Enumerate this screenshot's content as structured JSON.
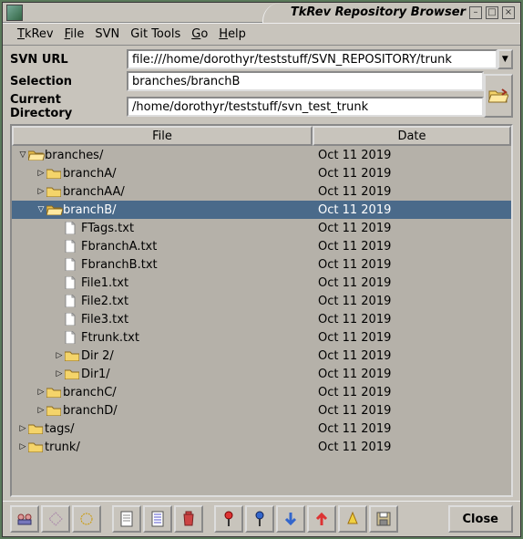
{
  "window": {
    "title": "TkRev Repository Browser"
  },
  "menubar": [
    {
      "label": "TkRev",
      "ul": 0
    },
    {
      "label": "File",
      "ul": 0
    },
    {
      "label": "SVN",
      "ul": -1
    },
    {
      "label": "Git Tools",
      "ul": -1
    },
    {
      "label": "Go",
      "ul": 0
    },
    {
      "label": "Help",
      "ul": 0
    }
  ],
  "fields": {
    "svn_url_label": "SVN URL",
    "svn_url_value": "file:///home/dorothyr/teststuff/SVN_REPOSITORY/trunk",
    "selection_label": "Selection",
    "selection_value": "branches/branchB",
    "curdir_label": "Current Directory",
    "curdir_value": "/home/dorothyr/teststuff/svn_test_trunk"
  },
  "columns": {
    "file": "File",
    "date": "Date"
  },
  "tree": [
    {
      "depth": 0,
      "exp": "open",
      "icon": "folder-open",
      "name": "branches/",
      "date": "Oct 11 2019",
      "sel": false
    },
    {
      "depth": 1,
      "exp": "closed",
      "icon": "folder",
      "name": "branchA/",
      "date": "Oct 11 2019",
      "sel": false
    },
    {
      "depth": 1,
      "exp": "closed",
      "icon": "folder",
      "name": "branchAA/",
      "date": "Oct 11 2019",
      "sel": false
    },
    {
      "depth": 1,
      "exp": "open",
      "icon": "folder-open",
      "name": "branchB/",
      "date": "Oct 11 2019",
      "sel": true
    },
    {
      "depth": 2,
      "exp": "none",
      "icon": "file",
      "name": "FTags.txt",
      "date": "Oct 11 2019",
      "sel": false
    },
    {
      "depth": 2,
      "exp": "none",
      "icon": "file",
      "name": "FbranchA.txt",
      "date": "Oct 11 2019",
      "sel": false
    },
    {
      "depth": 2,
      "exp": "none",
      "icon": "file",
      "name": "FbranchB.txt",
      "date": "Oct 11 2019",
      "sel": false
    },
    {
      "depth": 2,
      "exp": "none",
      "icon": "file",
      "name": "File1.txt",
      "date": "Oct 11 2019",
      "sel": false
    },
    {
      "depth": 2,
      "exp": "none",
      "icon": "file",
      "name": "File2.txt",
      "date": "Oct 11 2019",
      "sel": false
    },
    {
      "depth": 2,
      "exp": "none",
      "icon": "file",
      "name": "File3.txt",
      "date": "Oct 11 2019",
      "sel": false
    },
    {
      "depth": 2,
      "exp": "none",
      "icon": "file",
      "name": "Ftrunk.txt",
      "date": "Oct 11 2019",
      "sel": false
    },
    {
      "depth": 2,
      "exp": "closed",
      "icon": "folder",
      "name": "Dir 2/",
      "date": "Oct 11 2019",
      "sel": false
    },
    {
      "depth": 2,
      "exp": "closed",
      "icon": "folder",
      "name": "Dir1/",
      "date": "Oct 11 2019",
      "sel": false
    },
    {
      "depth": 1,
      "exp": "closed",
      "icon": "folder",
      "name": "branchC/",
      "date": "Oct 11 2019",
      "sel": false
    },
    {
      "depth": 1,
      "exp": "closed",
      "icon": "folder",
      "name": "branchD/",
      "date": "Oct 11 2019",
      "sel": false
    },
    {
      "depth": 0,
      "exp": "closed",
      "icon": "folder",
      "name": "tags/",
      "date": "Oct 11 2019",
      "sel": false
    },
    {
      "depth": 0,
      "exp": "closed",
      "icon": "folder",
      "name": "trunk/",
      "date": "Oct 11 2019",
      "sel": false
    }
  ],
  "toolbar": {
    "close_label": "Close",
    "buttons": [
      {
        "name": "who-icon",
        "g": "who"
      },
      {
        "name": "diamond-icon",
        "g": "diamond"
      },
      {
        "name": "circle-icon",
        "g": "circle"
      },
      {
        "sep": true
      },
      {
        "name": "page-icon",
        "g": "page"
      },
      {
        "name": "page-lines-icon",
        "g": "pagelines"
      },
      {
        "name": "trash-icon",
        "g": "trash"
      },
      {
        "sep": true
      },
      {
        "name": "pin-red-icon",
        "g": "pin-red"
      },
      {
        "name": "pin-blue-icon",
        "g": "pin-blue"
      },
      {
        "name": "arrow-down-icon",
        "g": "arrow-down"
      },
      {
        "name": "arrow-up-icon",
        "g": "arrow-up"
      },
      {
        "name": "cone-icon",
        "g": "cone"
      },
      {
        "name": "disk-icon",
        "g": "disk"
      }
    ]
  }
}
